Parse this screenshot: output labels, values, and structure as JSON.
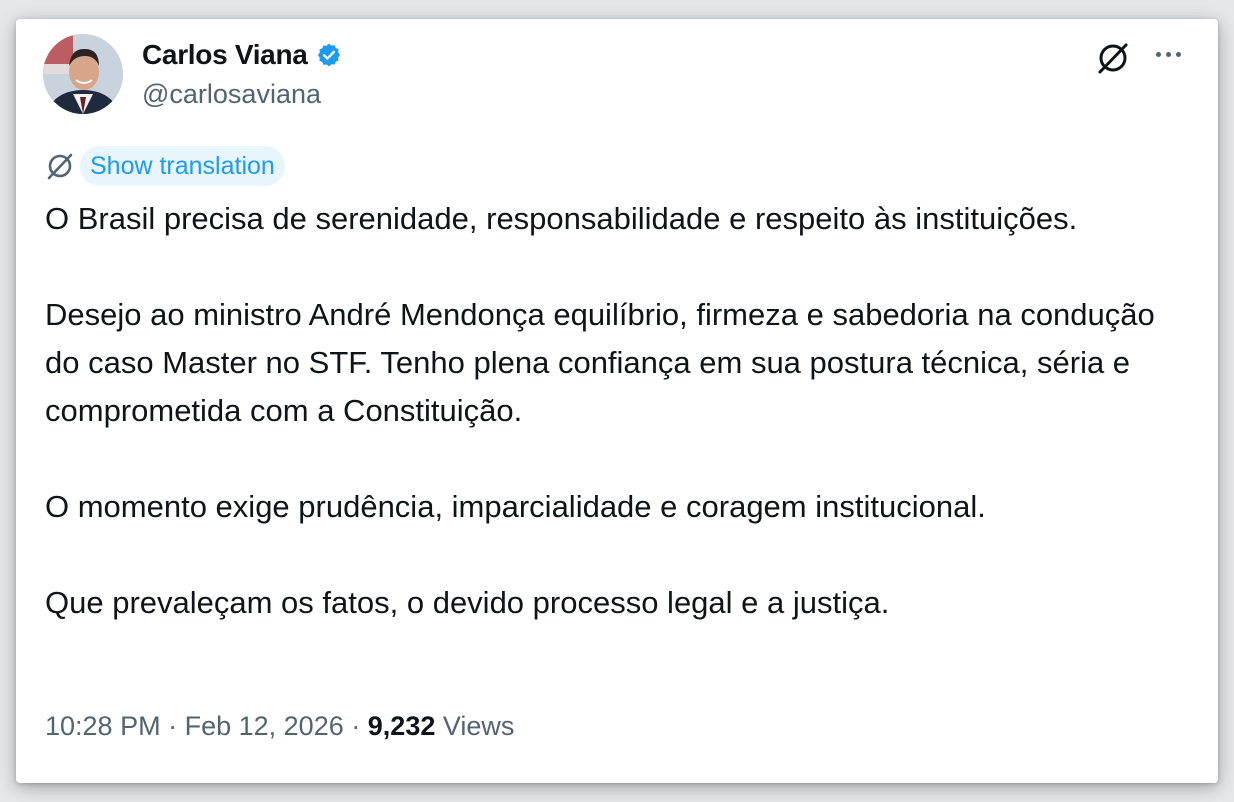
{
  "author": {
    "display_name": "Carlos Viana",
    "handle": "@carlosaviana",
    "verified": true,
    "verified_icon": "verified-badge-icon",
    "avatar": "avatar-photo"
  },
  "header_actions": {
    "grok_icon": "grok-icon",
    "more_icon": "more-options-icon"
  },
  "translation": {
    "icon": "grok-icon",
    "label": "Show translation"
  },
  "tweet": {
    "paragraphs": [
      "O Brasil precisa de serenidade, responsabilidade e respeito às instituições.",
      "Desejo ao ministro André Mendonça equilíbrio, firmeza e sabedoria na condução do caso Master no STF. Tenho plena confiança em sua postura técnica, séria e comprometida com a Constituição.",
      "O momento exige prudência, imparcialidade e coragem institucional.",
      "Que prevaleçam os fatos, o devido processo legal e a justiça."
    ]
  },
  "meta": {
    "time": "10:28 PM",
    "separator": "·",
    "date": "Feb 12, 2026",
    "views_count": "9,232",
    "views_label": "Views"
  },
  "colors": {
    "accent": "#1d9bf0",
    "text_primary": "#0f1419",
    "text_secondary": "#536471",
    "translate_bg": "#e8f5fd"
  }
}
